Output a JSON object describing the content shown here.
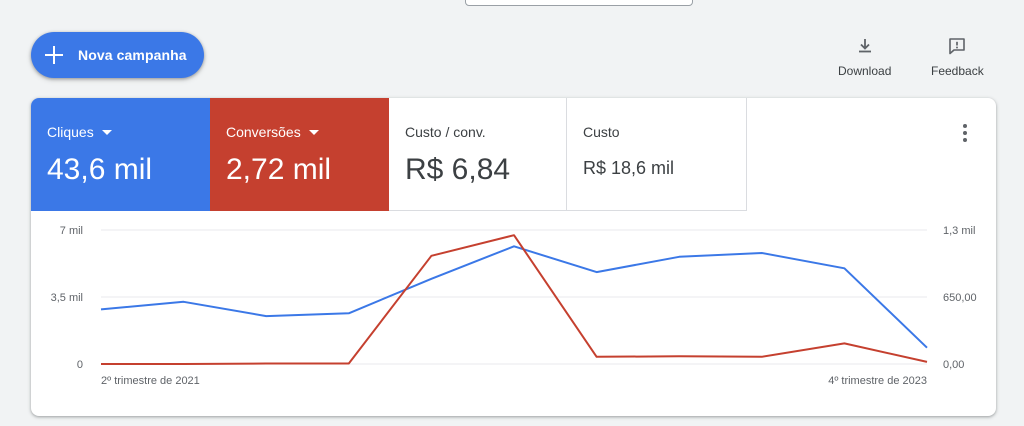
{
  "toolbar": {
    "new_campaign_label": "Nova campanha",
    "download_label": "Download",
    "feedback_label": "Feedback"
  },
  "metrics": {
    "clicks": {
      "label": "Cliques",
      "value": "43,6 mil",
      "color": "#3b78e7"
    },
    "conversions": {
      "label": "Conversões",
      "value": "2,72 mil",
      "color": "#c5402f"
    },
    "cost_per_conv": {
      "label": "Custo / conv.",
      "value": "R$ 6,84"
    },
    "cost": {
      "label": "Custo",
      "value": "R$ 18,6 mil"
    }
  },
  "chart_data": {
    "type": "line",
    "x_start_label": "2º trimestre de 2021",
    "x_end_label": "4º trimestre de 2023",
    "x": [
      "",
      "",
      "",
      "",
      "",
      "",
      "",
      "",
      "",
      "",
      ""
    ],
    "left_axis": {
      "ticks": [
        "0",
        "3,5 mil",
        "7 mil"
      ],
      "ylim": [
        0,
        7000
      ]
    },
    "right_axis": {
      "ticks": [
        "0,00",
        "650,00",
        "1,3 mil"
      ],
      "ylim": [
        0,
        1300
      ]
    },
    "grid": true,
    "series": [
      {
        "name": "Cliques",
        "axis": "left",
        "color": "#3b78e7",
        "values": [
          2850,
          3250,
          2500,
          2650,
          4450,
          6150,
          4800,
          5600,
          5800,
          5000,
          850
        ]
      },
      {
        "name": "Conversões",
        "axis": "right",
        "color": "#c5402f",
        "values": [
          0,
          0,
          5,
          5,
          1050,
          1250,
          70,
          75,
          70,
          200,
          20
        ]
      }
    ]
  }
}
